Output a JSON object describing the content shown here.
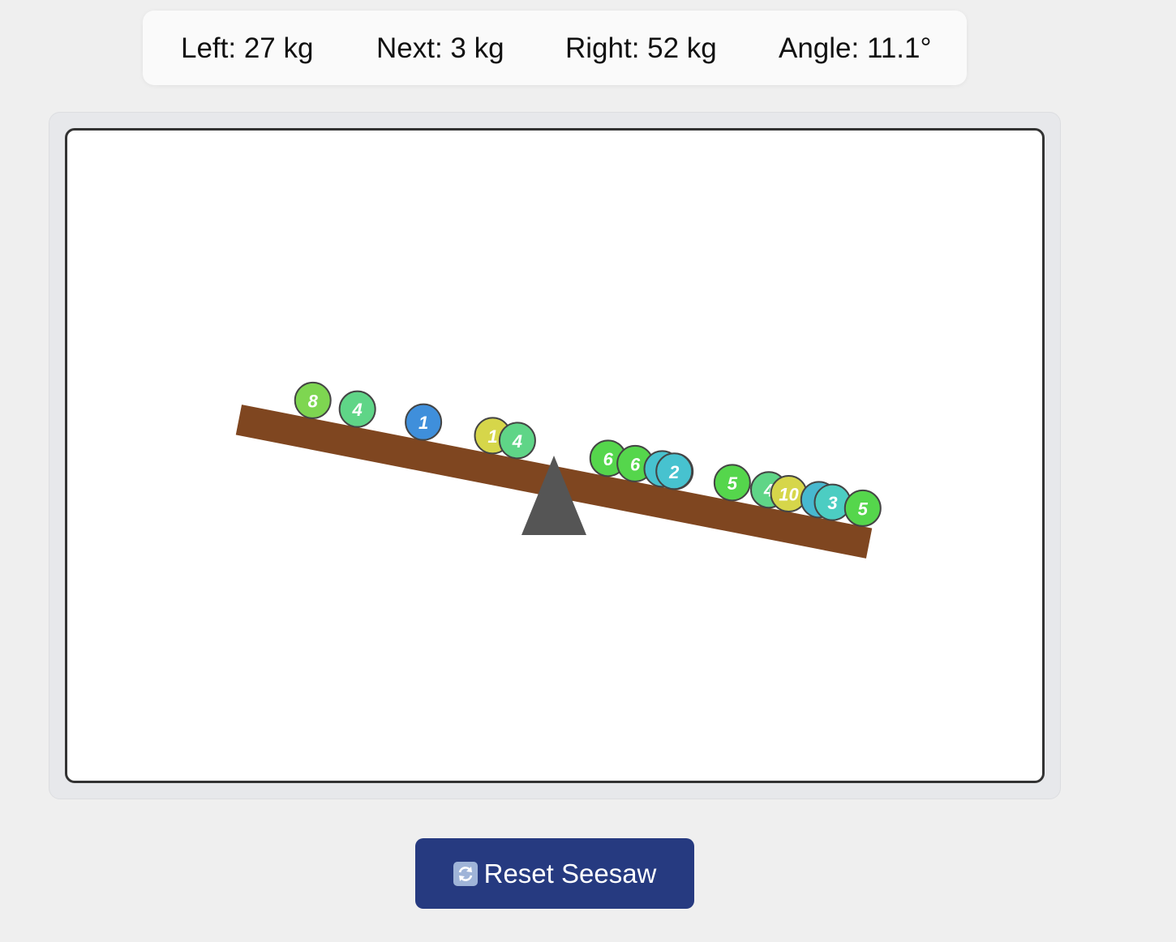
{
  "stats": {
    "left": "Left: 27 kg",
    "next": "Next: 3 kg",
    "right": "Right: 52 kg",
    "angle": "Angle: 11.1°"
  },
  "seesaw": {
    "angle_deg": 11.1,
    "plank_color": "#7f4620",
    "pivot_color": "#555555",
    "balls": [
      {
        "label": "8",
        "color": "#7ed651",
        "side": "left"
      },
      {
        "label": "4",
        "color": "#5fd587",
        "side": "left"
      },
      {
        "label": "1",
        "color": "#3f8fdb",
        "side": "left"
      },
      {
        "label": "1",
        "color": "#d6d64a",
        "side": "left"
      },
      {
        "label": "4",
        "color": "#5fd587",
        "side": "left"
      },
      {
        "label": "6",
        "color": "#55d64c",
        "side": "right"
      },
      {
        "label": "6",
        "color": "#55d64c",
        "side": "right"
      },
      {
        "label": "",
        "color": "#47c2cf",
        "side": "right"
      },
      {
        "label": "",
        "color": "#55d64c",
        "side": "right"
      },
      {
        "label": "2",
        "color": "#47c2cf",
        "side": "right"
      },
      {
        "label": "5",
        "color": "#55d64c",
        "side": "right"
      },
      {
        "label": "4",
        "color": "#5fd587",
        "side": "right"
      },
      {
        "label": "10",
        "color": "#d6d64a",
        "side": "right"
      },
      {
        "label": "",
        "color": "#47b8cf",
        "side": "right"
      },
      {
        "label": "3",
        "color": "#4ccdc2",
        "side": "right"
      },
      {
        "label": "5",
        "color": "#55d64c",
        "side": "right"
      }
    ]
  },
  "controls": {
    "reset_label": "Reset Seesaw",
    "reset_icon": "refresh-icon"
  }
}
